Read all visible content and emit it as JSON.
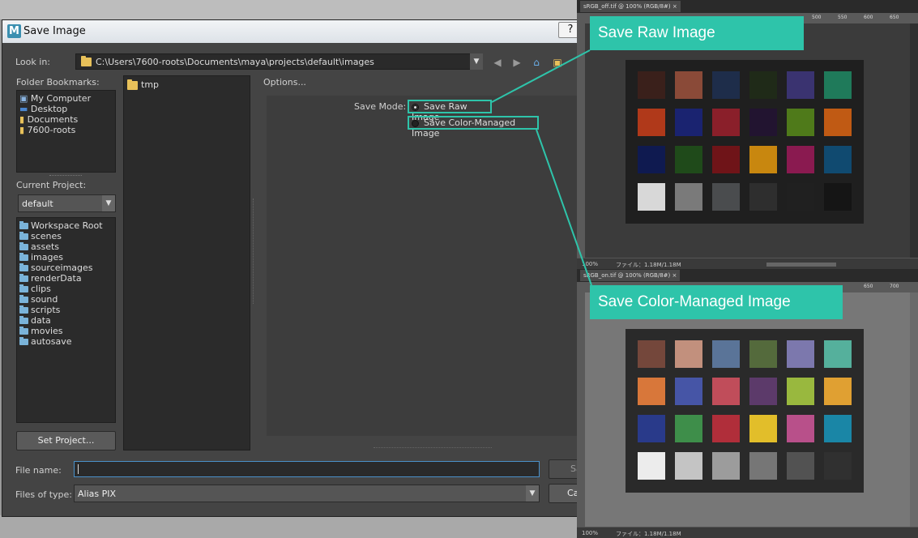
{
  "dialog": {
    "title": "Save Image",
    "app_icon_letter": "M",
    "help_label": "?",
    "look_in_label": "Look in:",
    "look_in_path": "C:\\Users\\7600-roots\\Documents\\maya\\projects\\default\\images",
    "folder_bookmarks_label": "Folder Bookmarks:",
    "bookmarks": [
      "My Computer",
      "Desktop",
      "Documents",
      "7600-roots"
    ],
    "current_project_label": "Current Project:",
    "current_project_value": "default",
    "project_folders": [
      "Workspace Root",
      "scenes",
      "assets",
      "images",
      "sourceimages",
      "renderData",
      "clips",
      "sound",
      "scripts",
      "data",
      "movies",
      "autosave"
    ],
    "set_project_label": "Set Project...",
    "file_entries": [
      "tmp"
    ],
    "options_label": "Options...",
    "save_mode_label": "Save Mode:",
    "save_modes": [
      {
        "label": "Save Raw Image",
        "selected": true
      },
      {
        "label": "Save Color-Managed Image",
        "selected": false
      }
    ],
    "file_name_label": "File name:",
    "file_name_value": "",
    "files_of_type_label": "Files of type:",
    "files_of_type_value": "Alias PIX",
    "save_button": "Sa",
    "cancel_button": "Ca"
  },
  "viewers": [
    {
      "tab": "sRGB_off.tif @ 100% (RGB/8#)",
      "callout": "Save Raw Image",
      "zoom": "100%",
      "file_info": "ファイル：1.18M/1.18M",
      "ruler_ticks": [
        "500",
        "550",
        "600",
        "650"
      ],
      "background": "#3b3b3b",
      "swatches": [
        "#3a201b",
        "#8a4a38",
        "#1e2d4a",
        "#1f2a18",
        "#3a3370",
        "#1f7a5a",
        "#b0391a",
        "#1a2370",
        "#8a1f2a",
        "#221430",
        "#4f7a1a",
        "#c05a14",
        "#0f1a50",
        "#1f4a1a",
        "#6f1418",
        "#c8870f",
        "#8a1a50",
        "#104a70",
        "#d8d8d8",
        "#7a7a7a",
        "#4a4c4e",
        "#2e2e2e",
        "#202020",
        "#151515"
      ]
    },
    {
      "tab": "sRGB_on.tif @ 100% (RGB/8#)",
      "callout": "Save Color-Managed Image",
      "zoom": "100%",
      "file_info": "ファイル：1.18M/1.18M",
      "ruler_ticks": [
        "650",
        "700"
      ],
      "background": "#777777",
      "swatches": [
        "#74473b",
        "#c2907d",
        "#5a7498",
        "#546a3c",
        "#7c78ad",
        "#55b09c",
        "#d8773a",
        "#4655a6",
        "#c04d5a",
        "#5c3a6a",
        "#99b83e",
        "#e0a032",
        "#293a8a",
        "#3e8e4a",
        "#b02e3a",
        "#e2be2a",
        "#b8508a",
        "#1a86a6",
        "#ececec",
        "#c4c4c4",
        "#9c9c9c",
        "#767676",
        "#525252",
        "#303030"
      ]
    }
  ],
  "colors": {
    "accent": "#2ec4aa"
  }
}
